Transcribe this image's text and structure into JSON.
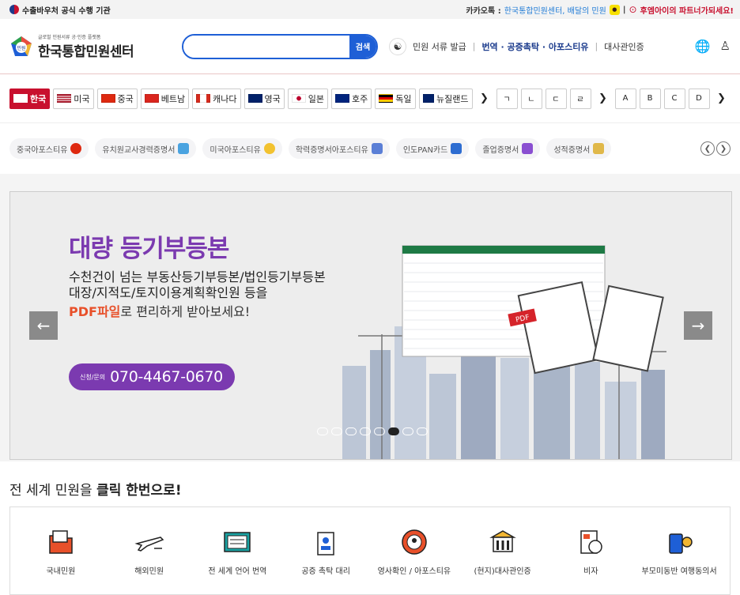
{
  "topbar": {
    "left_text": "수출바우처 공식 수행 기관",
    "kakao_prefix": "카카오톡 :",
    "kakao_link": "한국통합민원센터, 배달의 민원",
    "partner_text": "후엠아이의 파트너가되세요!"
  },
  "header": {
    "logo_sub": "글로벌 민원서류 공·인증 플랫폼",
    "logo_name": "한국통합민원센터",
    "logo_badge": "민원",
    "search_placeholder": "",
    "search_button": "검색",
    "nav_issue": "민원 서류 발급",
    "nav_services": "번역 · 공증촉탁 · 아포스티유",
    "nav_embassy": "대사관인증"
  },
  "countries": [
    {
      "label": "한국",
      "active": true
    },
    {
      "label": "미국",
      "active": false
    },
    {
      "label": "중국",
      "active": false
    },
    {
      "label": "베트남",
      "active": false
    },
    {
      "label": "캐나다",
      "active": false
    },
    {
      "label": "영국",
      "active": false
    },
    {
      "label": "일본",
      "active": false
    },
    {
      "label": "호주",
      "active": false
    },
    {
      "label": "독일",
      "active": false
    },
    {
      "label": "뉴질랜드",
      "active": false
    }
  ],
  "korean_letters": [
    "ㄱ",
    "ㄴ",
    "ㄷ",
    "ㄹ"
  ],
  "latin_letters": [
    "A",
    "B",
    "C",
    "D"
  ],
  "chips": [
    {
      "label": "중국아포스티유"
    },
    {
      "label": "유치원교사경력증명서"
    },
    {
      "label": "미국아포스티유"
    },
    {
      "label": "학력증명서아포스티유"
    },
    {
      "label": "인도PAN카드"
    },
    {
      "label": "졸업증명서"
    },
    {
      "label": "성적증명서"
    }
  ],
  "banner": {
    "title": "대량 등기부등본",
    "line1": "수천건이 넘는 부동산등기부등본/법인등기부등본",
    "line2": "대장/지적도/토지이용계획확인원 등을",
    "line3_highlight": "PDF파일",
    "line3_rest": "로 편리하게 받아보세요!",
    "pill_small": "신청/문의",
    "pill_number": "070-4467-0670",
    "pdf_label": "PDF",
    "dot_count": 8,
    "active_dot": 5
  },
  "section": {
    "title_prefix": "전 세계 민원을",
    "title_bold": "클릭 한번으로!"
  },
  "services": [
    {
      "label": "국내민원",
      "icon": "folder-icon"
    },
    {
      "label": "해외민원",
      "icon": "airplane-icon"
    },
    {
      "label": "전 세계 언어 번역",
      "icon": "document-icon"
    },
    {
      "label": "공증 촉탁 대리",
      "icon": "id-badge-icon"
    },
    {
      "label": "영사확인 / 아포스티유",
      "icon": "gear-person-icon"
    },
    {
      "label": "(현지)대사관인증",
      "icon": "embassy-icon"
    },
    {
      "label": "비자",
      "icon": "visa-icon"
    },
    {
      "label": "부모미동반 여행동의서",
      "icon": "luggage-icon"
    }
  ],
  "colors": {
    "accent": "#c8102e",
    "brand_blue": "#1e5fd6",
    "purple": "#7b3ab0",
    "orange": "#e8502a"
  }
}
